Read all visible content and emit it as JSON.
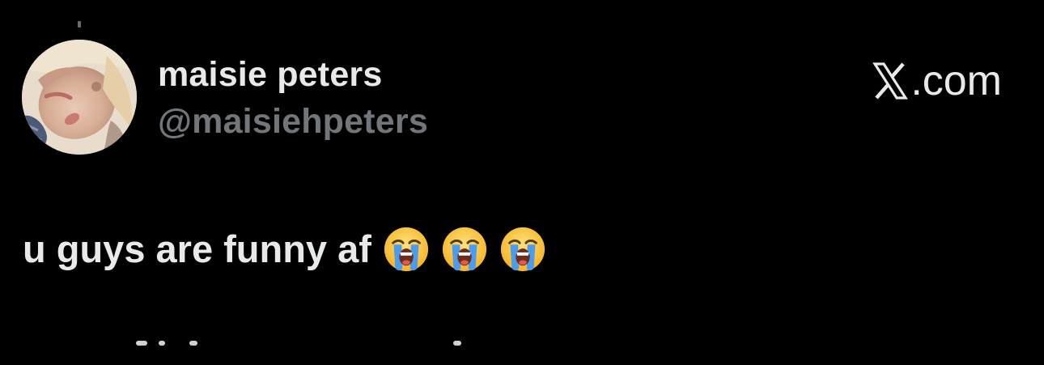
{
  "author": {
    "display_name": "maisie peters",
    "handle": "@maisiehpeters"
  },
  "brand": {
    "domain_suffix": ".com",
    "logo_icon": "x-logo-icon"
  },
  "tweet": {
    "text": "u guys are funny af",
    "emojis": [
      "loudly-crying-face-icon",
      "loudly-crying-face-icon",
      "loudly-crying-face-icon"
    ]
  },
  "colors": {
    "background": "#000000",
    "primary_text": "#e7e9ea",
    "secondary_text": "#71767b"
  }
}
